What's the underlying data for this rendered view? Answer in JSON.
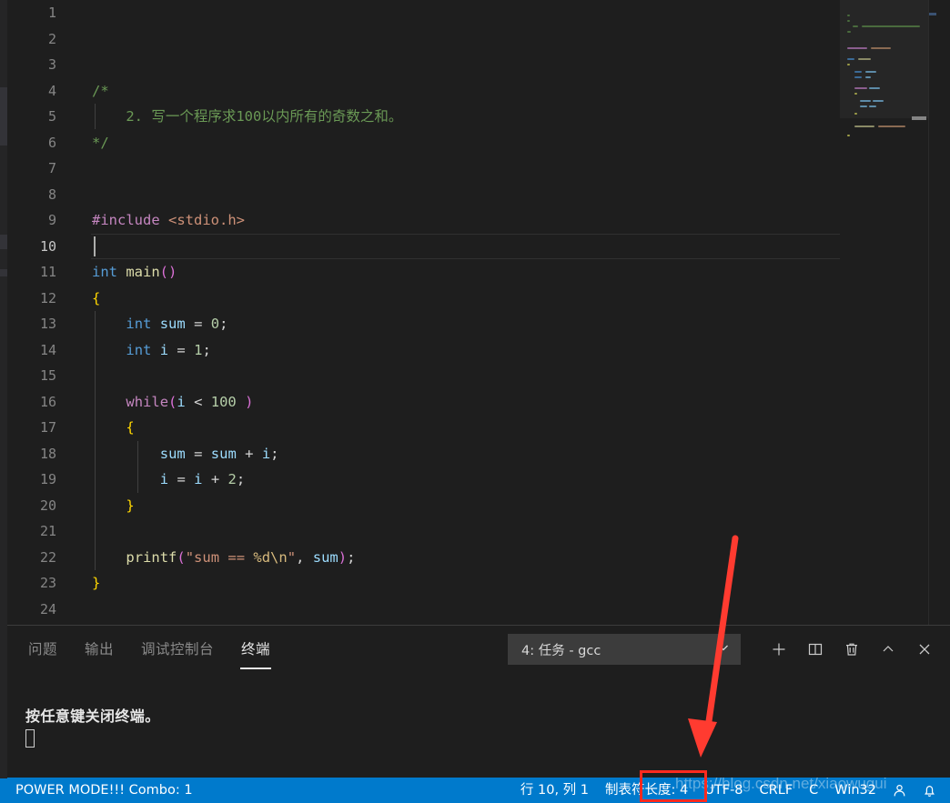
{
  "editor": {
    "language_colors": {
      "comment": "#6A9955",
      "keyword": "#569CD6",
      "control": "#C586C0",
      "function": "#DCDCAA",
      "variable": "#9CDCFE",
      "string": "#CE9178",
      "number": "#B5CEA8",
      "background": "#1E1E1E"
    },
    "lines": [
      {
        "n": "1",
        "text": ""
      },
      {
        "n": "2",
        "text": ""
      },
      {
        "n": "3",
        "text": ""
      },
      {
        "n": "4",
        "text": "/*"
      },
      {
        "n": "5",
        "text": "    2. 写一个程序求100以内所有的奇数之和。"
      },
      {
        "n": "6",
        "text": "*/"
      },
      {
        "n": "7",
        "text": ""
      },
      {
        "n": "8",
        "text": ""
      },
      {
        "n": "9",
        "text": "#include <stdio.h>"
      },
      {
        "n": "10",
        "text": ""
      },
      {
        "n": "11",
        "text": "int main()"
      },
      {
        "n": "12",
        "text": "{"
      },
      {
        "n": "13",
        "text": "    int sum = 0;"
      },
      {
        "n": "14",
        "text": "    int i = 1;"
      },
      {
        "n": "15",
        "text": ""
      },
      {
        "n": "16",
        "text": "    while(i < 100 )"
      },
      {
        "n": "17",
        "text": "    {"
      },
      {
        "n": "18",
        "text": "        sum = sum + i;"
      },
      {
        "n": "19",
        "text": "        i = i + 2;"
      },
      {
        "n": "20",
        "text": "    }"
      },
      {
        "n": "21",
        "text": ""
      },
      {
        "n": "22",
        "text": "    printf(\"sum == %d\\n\", sum);"
      },
      {
        "n": "23",
        "text": "}"
      },
      {
        "n": "24",
        "text": ""
      }
    ],
    "active_line": "10"
  },
  "panel": {
    "tabs": [
      {
        "label": "问题",
        "active": false
      },
      {
        "label": "输出",
        "active": false
      },
      {
        "label": "调试控制台",
        "active": false
      },
      {
        "label": "终端",
        "active": true
      }
    ],
    "terminal_select": {
      "value": "4: 任务 - gcc",
      "chevron": "chevron-down-icon"
    },
    "actions": [
      {
        "icon": "new-terminal-plus-icon",
        "label": "+"
      },
      {
        "icon": "split-terminal-icon",
        "label": ""
      },
      {
        "icon": "kill-terminal-trash-icon",
        "label": ""
      },
      {
        "icon": "maximize-panel-chevron-up-icon",
        "label": ""
      },
      {
        "icon": "close-panel-x-icon",
        "label": ""
      }
    ],
    "terminal_output": "按任意键关闭终端。"
  },
  "statusbar": {
    "background": "#007ACC",
    "left": {
      "power_mode": "POWER MODE!!! Combo: 1"
    },
    "right": {
      "cursor_position": "行 10, 列 1",
      "tab_size": "制表符长度: 4",
      "encoding": "UTF-8",
      "eol": "CRLF",
      "language": "C",
      "platform": "Win32",
      "feedback_icon": "person-feedback-icon",
      "notifications_icon": "bell-icon"
    }
  },
  "annotations": {
    "highlight_target": "UTF-8",
    "highlight_color": "#FF2A1F",
    "arrow_color": "#FF3B30"
  },
  "watermark": {
    "text": "https://blog.csdn.net/xiaowugui"
  }
}
